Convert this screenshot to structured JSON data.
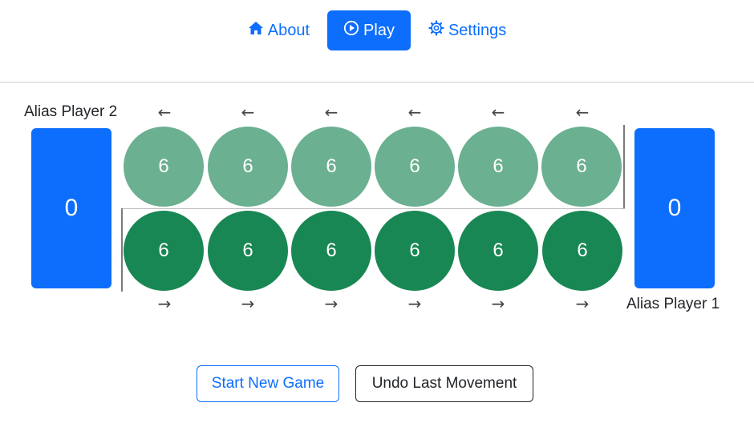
{
  "nav": {
    "about": {
      "label": "About",
      "icon": "house-icon"
    },
    "play": {
      "label": "Play",
      "icon": "play-circle-icon"
    },
    "settings": {
      "label": "Settings",
      "icon": "gear-icon"
    }
  },
  "colors": {
    "primary": "#0d6efd",
    "pit_player2": "#6bb091",
    "pit_player1": "#198754"
  },
  "board": {
    "player2": {
      "alias": "Alias Player 2",
      "store": "0",
      "pits": [
        "6",
        "6",
        "6",
        "6",
        "6",
        "6"
      ],
      "arrow": "←"
    },
    "player1": {
      "alias": "Alias Player 1",
      "store": "0",
      "pits": [
        "6",
        "6",
        "6",
        "6",
        "6",
        "6"
      ],
      "arrow": "→"
    }
  },
  "actions": {
    "new_game": "Start New Game",
    "undo": "Undo Last Movement"
  }
}
